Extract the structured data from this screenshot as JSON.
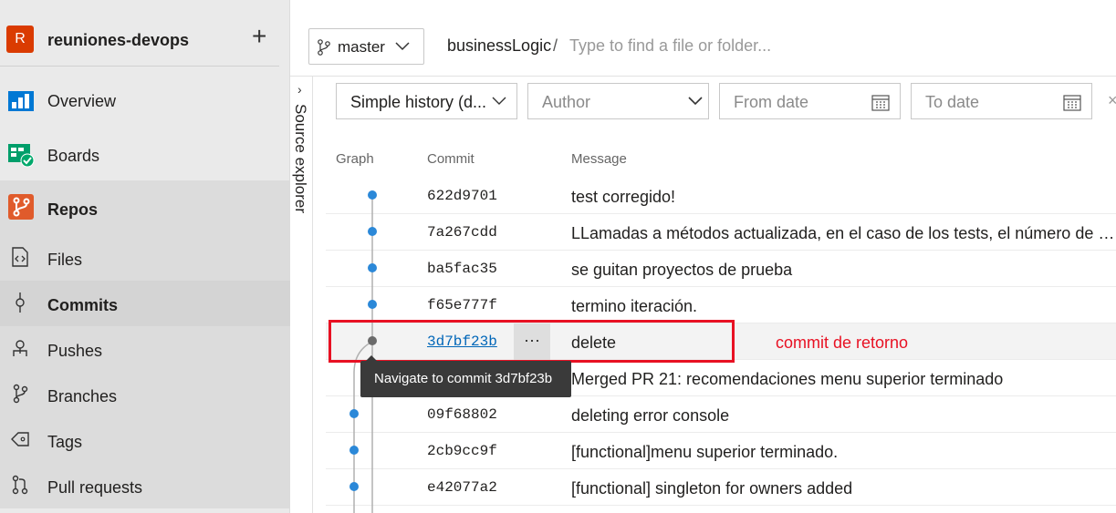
{
  "project": {
    "badge": "R",
    "name": "reuniones-devops",
    "add": "+"
  },
  "nav": {
    "overview": "Overview",
    "boards": "Boards",
    "repos": "Repos",
    "files": "Files",
    "commits": "Commits",
    "pushes": "Pushes",
    "branches": "Branches",
    "tags": "Tags",
    "pull_requests": "Pull requests"
  },
  "toolbar": {
    "branch": "master",
    "path": "businessLogic",
    "path_separator": "/",
    "path_placeholder": "Type to find a file or folder..."
  },
  "source_explorer": {
    "label": "Source explorer",
    "chevron": "›"
  },
  "filters": {
    "history": "Simple history (d...",
    "author": "Author",
    "from_date": "From date",
    "to_date": "To date",
    "close": "×"
  },
  "columns": {
    "graph": "Graph",
    "commit": "Commit",
    "message": "Message"
  },
  "commits": [
    {
      "hash": "622d9701",
      "message": "test corregido!"
    },
    {
      "hash": "7a267cdd",
      "message": "LLamadas a métodos actualizada, en el caso de los tests, el número de pará..."
    },
    {
      "hash": "ba5fac35",
      "message": "se guitan proyectos de prueba"
    },
    {
      "hash": "f65e777f",
      "message": "termino iteración."
    },
    {
      "hash": "3d7bf23b",
      "message": "delete",
      "more": "···"
    },
    {
      "hash": "",
      "message": "Merged PR 21: recomendaciones menu superior terminado"
    },
    {
      "hash": "09f68802",
      "message": "deleting error console"
    },
    {
      "hash": "2cb9cc9f",
      "message": "[functional]menu superior terminado."
    },
    {
      "hash": "e42077a2",
      "message": "[functional] singleton for owners added"
    }
  ],
  "tooltip": "Navigate to commit 3d7bf23b",
  "annotation": "commit de retorno",
  "colors": {
    "accent": "#0078d4",
    "annotation": "#e81123",
    "project_badge": "#da3b01"
  }
}
